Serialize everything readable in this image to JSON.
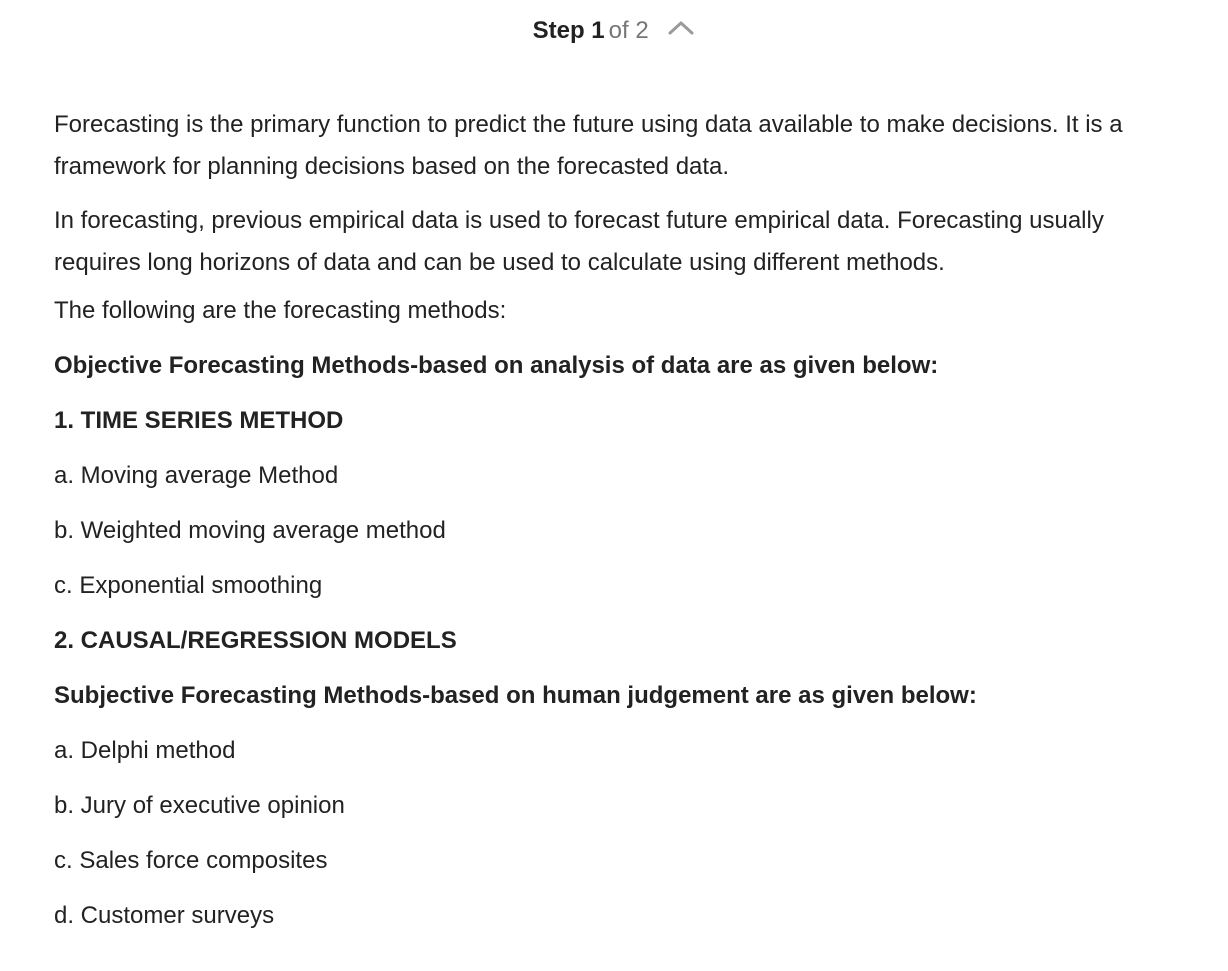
{
  "header": {
    "step_label": "Step 1",
    "step_of": "of 2",
    "collapse_icon": "chevron-up-icon",
    "chevron_color": "#9a9a9a"
  },
  "content": {
    "paragraph_1": "Forecasting is the primary function to predict the future using data available to make decisions. It is a framework for planning decisions based on the forecasted data.",
    "paragraph_2": "In forecasting, previous empirical data is used to forecast future empirical data. Forecasting usually requires long horizons of data and can be used to calculate using different methods.",
    "intro": "The following are the forecasting methods:",
    "objective_heading": "Objective Forecasting Methods-based on analysis of data are as given below:",
    "time_series_heading": "1. TIME SERIES METHOD",
    "time_series_items": [
      "a. Moving average Method",
      "b. Weighted moving average method",
      "c. Exponential smoothing"
    ],
    "causal_heading": "2. CAUSAL/REGRESSION MODELS",
    "subjective_heading": "Subjective Forecasting Methods-based on human judgement are as given below:",
    "subjective_items": [
      "a. Delphi method",
      "b. Jury of executive opinion",
      "c. Sales force composites",
      "d. Customer surveys"
    ]
  }
}
